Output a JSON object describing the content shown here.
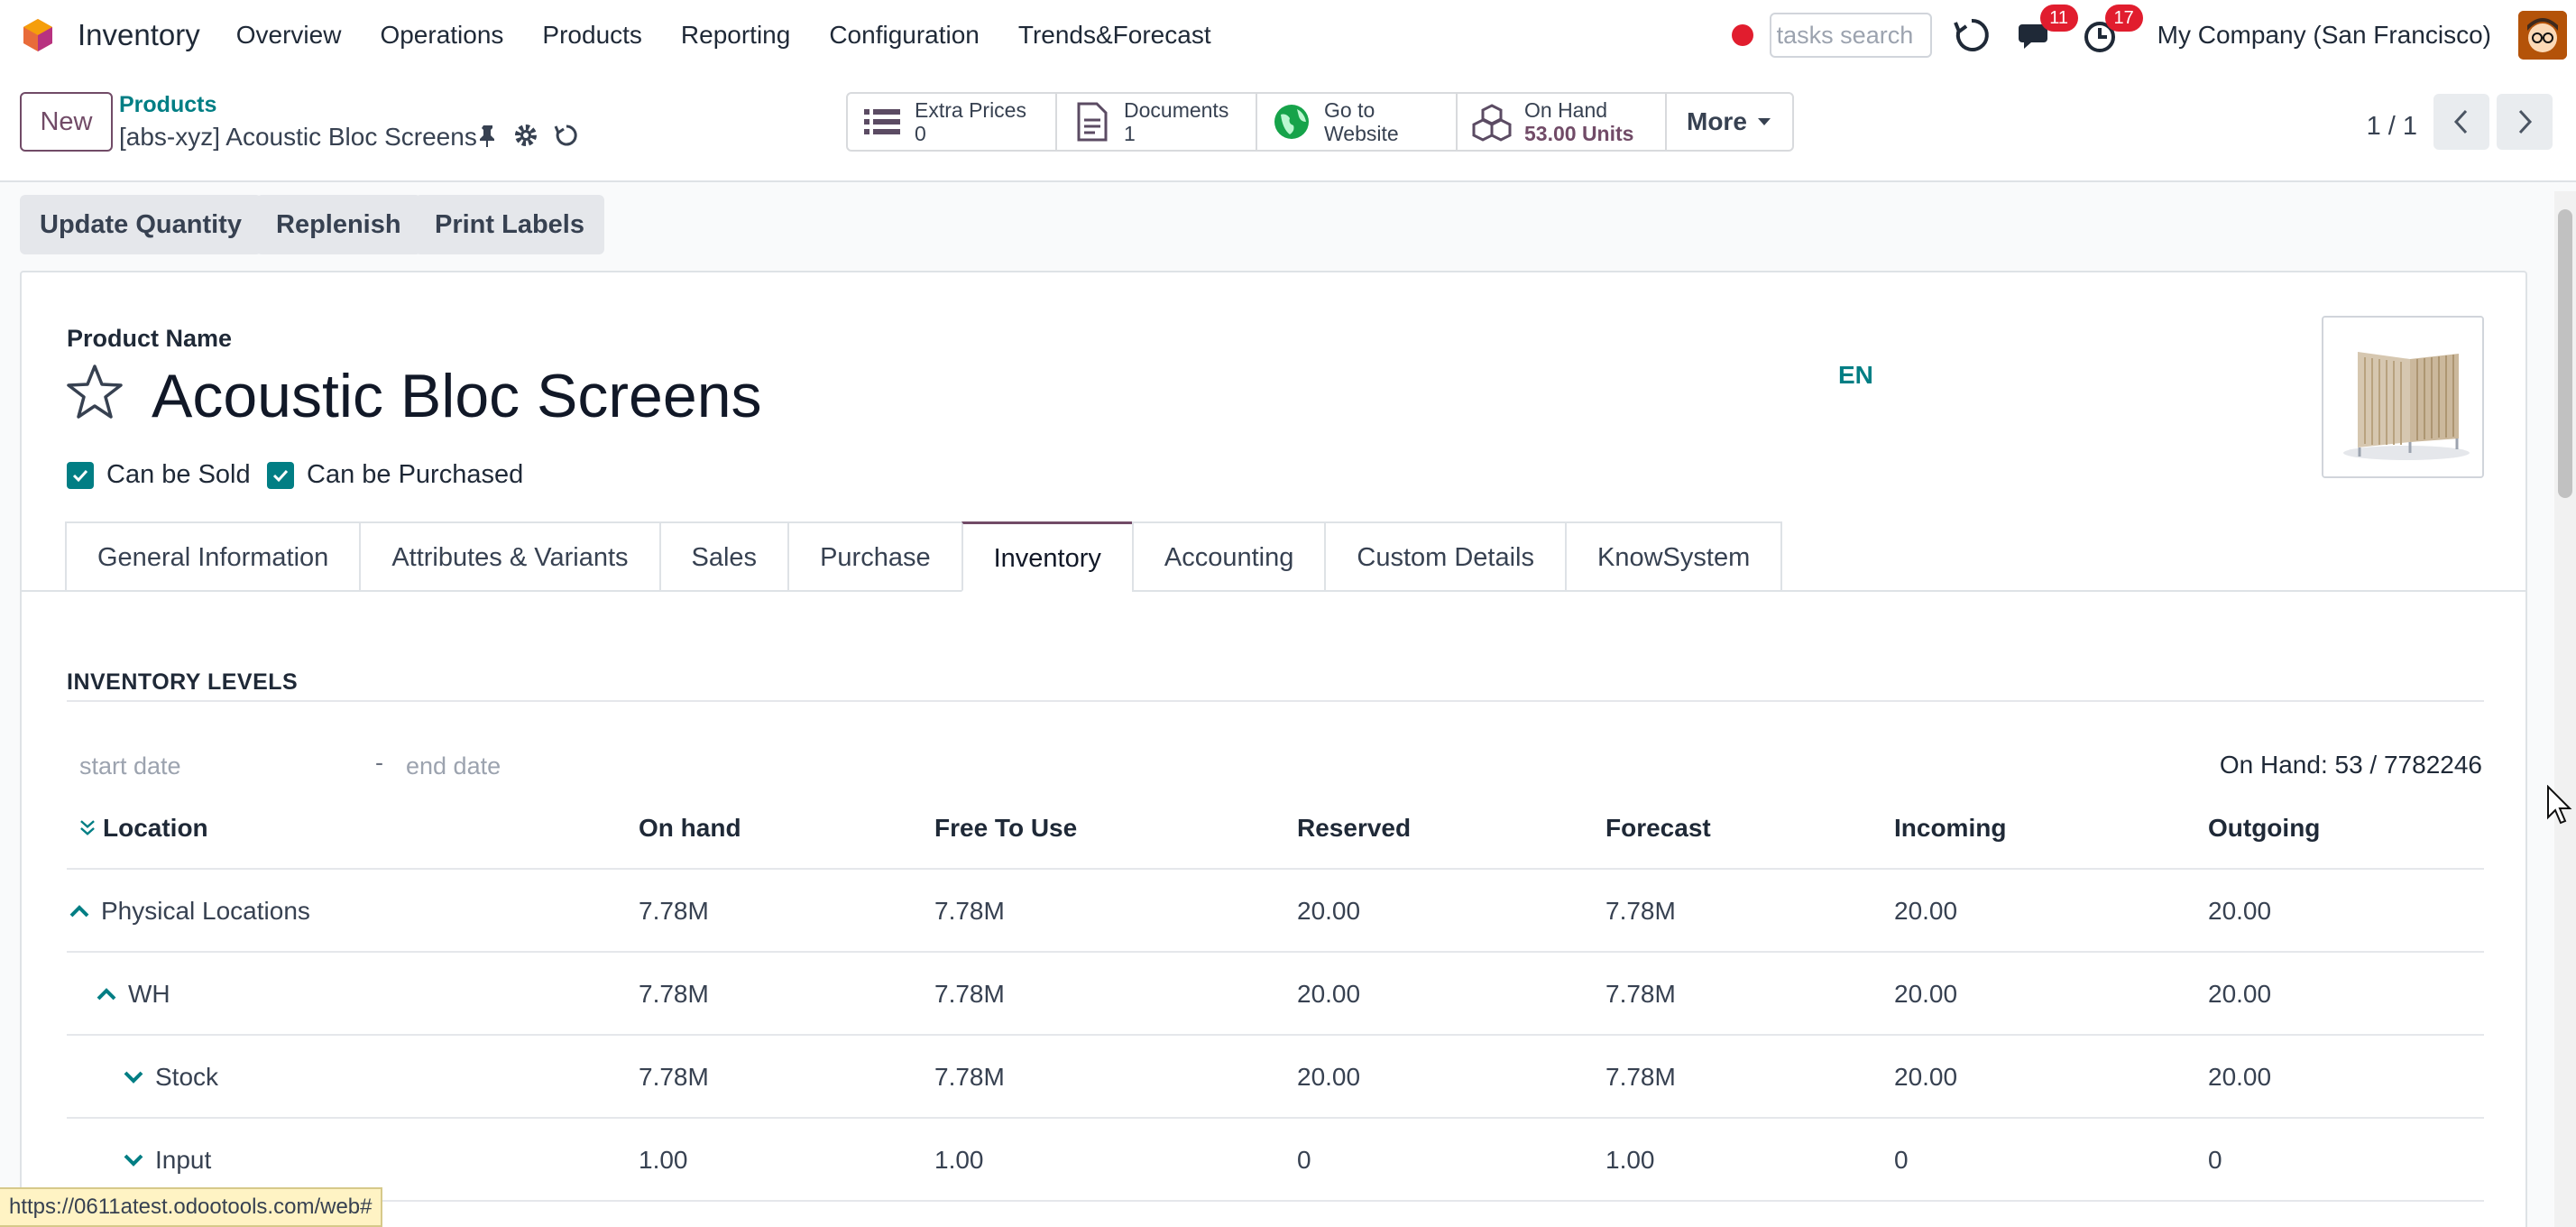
{
  "navbar": {
    "app_name": "Inventory",
    "menu": [
      "Overview",
      "Operations",
      "Products",
      "Reporting",
      "Configuration",
      "Trends&Forecast"
    ],
    "search_placeholder": "tasks search",
    "messages_badge": "11",
    "activities_badge": "17",
    "company": "My Company (San Francisco)"
  },
  "control": {
    "new_label": "New",
    "breadcrumb_parent": "Products",
    "breadcrumb_current": "[abs-xyz] Acoustic Bloc Screens",
    "stat_buttons": [
      {
        "label": "Extra Prices",
        "value": "0",
        "icon": "list-icon"
      },
      {
        "label": "Documents",
        "value": "1",
        "icon": "document-icon"
      },
      {
        "label": "Go to",
        "value": "Website",
        "icon": "globe-icon"
      },
      {
        "label": "On Hand",
        "value": "53.00 Units",
        "icon": "cubes-icon"
      }
    ],
    "more_label": "More",
    "pager": "1 / 1"
  },
  "actions": [
    "Update Quantity",
    "Replenish",
    "Print Labels"
  ],
  "form": {
    "product_name_label": "Product Name",
    "product_name": "Acoustic Bloc Screens",
    "lang": "EN",
    "can_be_sold": "Can be Sold",
    "can_be_purchased": "Can be Purchased",
    "tabs": [
      "General Information",
      "Attributes & Variants",
      "Sales",
      "Purchase",
      "Inventory",
      "Accounting",
      "Custom Details",
      "KnowSystem"
    ],
    "active_tab": "Inventory"
  },
  "inventory": {
    "title": "INVENTORY LEVELS",
    "start_placeholder": "start date",
    "date_sep": "-",
    "end_placeholder": "end date",
    "on_hand_summary": "On Hand: 53 / 7782246",
    "columns": [
      "Location",
      "On hand",
      "Free To Use",
      "Reserved",
      "Forecast",
      "Incoming",
      "Outgoing"
    ],
    "rows": [
      {
        "name": "Physical Locations",
        "on_hand": "7.78M",
        "free": "7.78M",
        "reserved": "20.00",
        "forecast": "7.78M",
        "incoming": "20.00",
        "outgoing": "20.00"
      },
      {
        "name": "WH",
        "on_hand": "7.78M",
        "free": "7.78M",
        "reserved": "20.00",
        "forecast": "7.78M",
        "incoming": "20.00",
        "outgoing": "20.00"
      },
      {
        "name": "Stock",
        "on_hand": "7.78M",
        "free": "7.78M",
        "reserved": "20.00",
        "forecast": "7.78M",
        "incoming": "20.00",
        "outgoing": "20.00"
      },
      {
        "name": "Input",
        "on_hand": "1.00",
        "free": "1.00",
        "reserved": "0",
        "forecast": "1.00",
        "incoming": "0",
        "outgoing": "0"
      }
    ]
  },
  "status_url": "https://0611atest.odootools.com/web#"
}
